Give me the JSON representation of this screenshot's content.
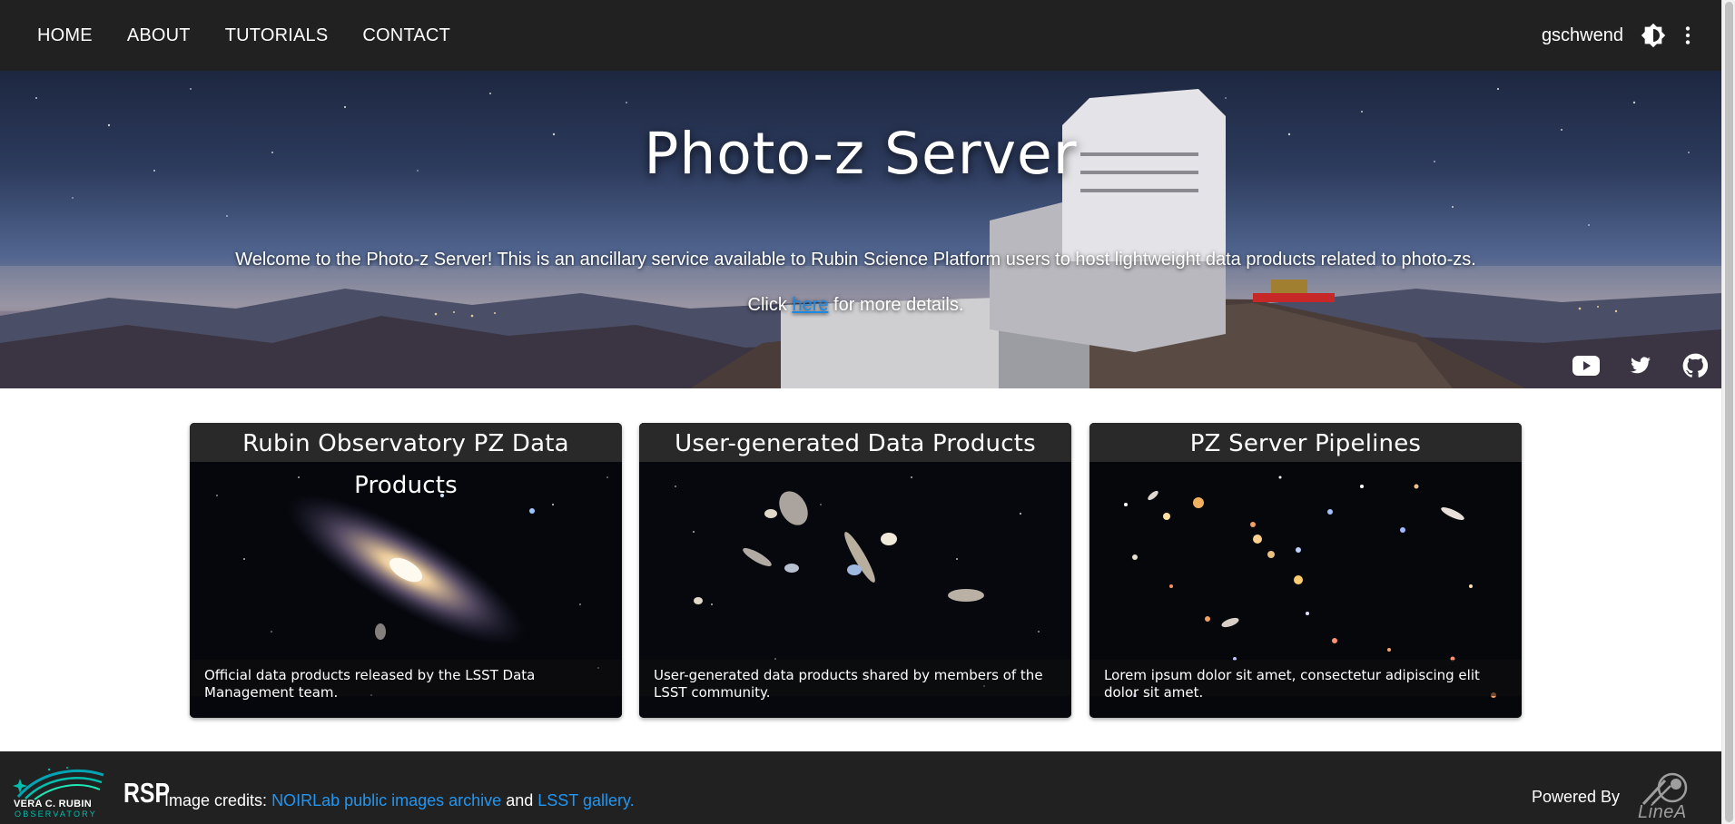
{
  "nav": {
    "items": [
      "HOME",
      "ABOUT",
      "TUTORIALS",
      "CONTACT"
    ],
    "username": "gschwend",
    "theme_icon": "brightness-icon",
    "menu_icon": "more-vert-icon"
  },
  "hero": {
    "title": "Photo-z Server",
    "welcome": "Welcome to the Photo-z Server! This is an ancillary service available to Rubin Science Platform users to host lightweight data products related to photo-zs.",
    "click_prefix": "Click",
    "click_link": "here",
    "click_suffix": "for more details.",
    "social_icons": [
      "youtube-icon",
      "twitter-icon",
      "github-icon"
    ]
  },
  "cards": [
    {
      "title": "Rubin Observatory PZ Data Products",
      "description": "Official data products released by the LSST Data Management team."
    },
    {
      "title": "User-generated Data Products",
      "description": "User-generated data products shared by members of the LSST community."
    },
    {
      "title": "PZ Server Pipelines",
      "description": "Lorem ipsum dolor sit amet, consectetur adipiscing elit dolor sit amet."
    }
  ],
  "footer": {
    "logo_rubin_line1": "VERA C. RUBIN",
    "logo_rubin_line2": "OBSERVATORY",
    "logo_rsp": "RSP",
    "credits_prefix": "Image credits:",
    "credits_link1": "NOIRLab public images archive",
    "credits_and": "and",
    "credits_link2": "LSST gallery.",
    "powered_by": "Powered By",
    "linea_logo": "LineA"
  },
  "colors": {
    "bar": "#212121",
    "link": "#2196f3",
    "card_title_bg": "#2d2d2d"
  }
}
